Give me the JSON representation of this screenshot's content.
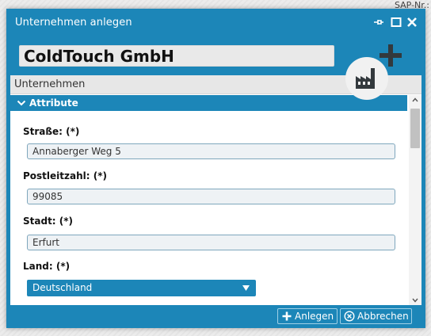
{
  "background": {
    "sap_label": "SAP-Nr.:"
  },
  "dialog": {
    "title": "Unternehmen anlegen",
    "company_name": "ColdTouch GmbH",
    "tab_label": "Unternehmen",
    "section": {
      "title": "Attribute"
    },
    "fields": [
      {
        "label": "Straße: (*)",
        "value": "Annaberger Weg 5"
      },
      {
        "label": "Postleitzahl: (*)",
        "value": "99085"
      },
      {
        "label": "Stadt: (*)",
        "value": "Erfurt"
      },
      {
        "label": "Land: (*)",
        "value": "Deutschland"
      }
    ],
    "buttons": {
      "create": "Anlegen",
      "cancel": "Abbrechen"
    },
    "icons": [
      "pin-icon",
      "maximize-icon",
      "close-icon",
      "factory-icon",
      "plus-icon",
      "chevron-down-icon",
      "scroll-up-icon",
      "scroll-down-icon",
      "circle-x-icon"
    ]
  },
  "colors": {
    "accent": "#1c86b8",
    "input_bg": "#eef2f5",
    "input_border": "#7fa7bd",
    "icon_dark": "#33393d"
  }
}
